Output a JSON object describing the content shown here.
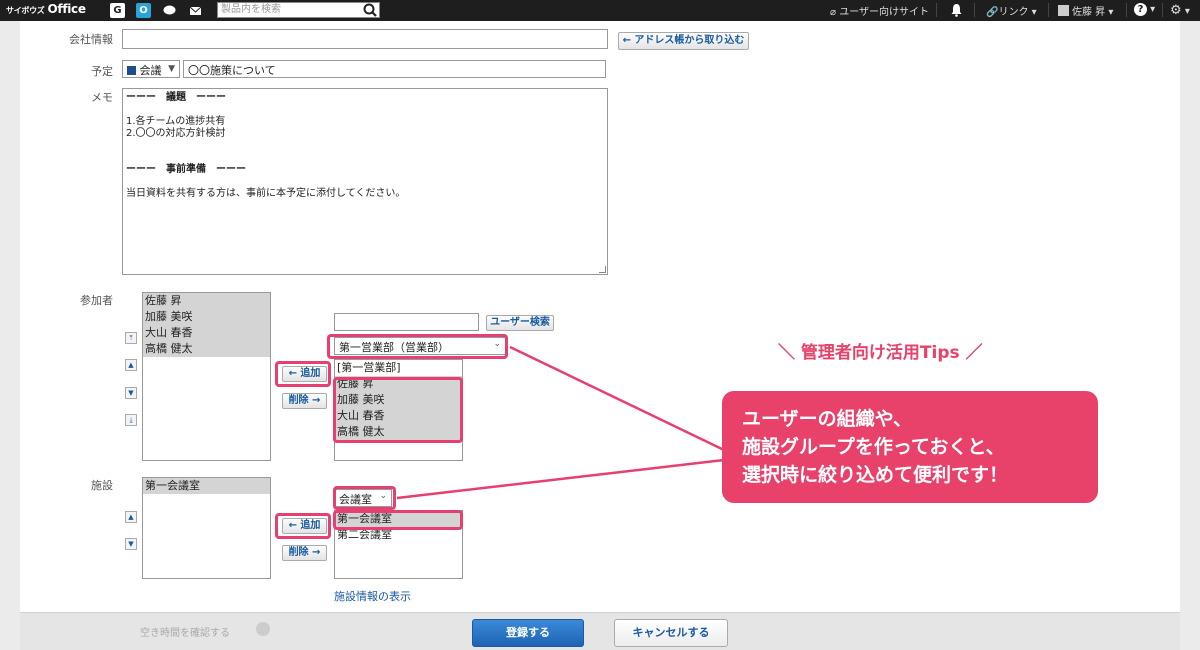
{
  "topbar": {
    "logo_small": "サイボウズ",
    "logo": "Office",
    "apps": [
      "G",
      "O"
    ],
    "search_placeholder": "製品内を検索",
    "user_site": "ユーザー向けサイト",
    "link": "リンク",
    "user": "佐藤 昇"
  },
  "form": {
    "company_label": "会社情報",
    "address_book_btn": "← アドレス帳から取り込む",
    "schedule_label": "予定",
    "category": "会議",
    "title_value": "〇〇施策について",
    "memo_label": "メモ",
    "memo_lines": [
      "ーーー　議題　ーーー",
      "",
      "1.各チームの進捗共有",
      "2.〇〇の対応方針検討",
      "",
      "",
      "ーーー　事前準備　ーーー",
      "",
      "当日資料を共有する方は、事前に本予定に添付してください。"
    ],
    "participants_label": "参加者",
    "participants": [
      "佐藤 昇",
      "加藤 美咲",
      "大山 春香",
      "高橋 健太"
    ],
    "user_search_btn": "ユーザー検索",
    "group_select": "第一営業部（営業部）",
    "group_header": "[第一営業部]",
    "group_members": [
      "佐藤 昇",
      "加藤 美咲",
      "大山 春香",
      "高橋 健太"
    ],
    "add_btn": "← 追加",
    "remove_btn": "削除 →",
    "facility_label": "施設",
    "facilities_selected": [
      "第一会議室"
    ],
    "facility_group_select": "会議室",
    "facility_options": [
      "第一会議室",
      "第二会議室"
    ],
    "facility_info_link": "施設情報の表示"
  },
  "footer": {
    "faded_text": "空き時間を確認する",
    "submit": "登録する",
    "cancel": "キャンセルする"
  },
  "annotation": {
    "tips": "＼ 管理者向け活用Tips ／",
    "callout_lines": [
      "ユーザーの組織や、",
      "施設グループを作っておくと、",
      "選択時に絞り込めて便利です！"
    ]
  },
  "colors": {
    "highlight": "#e64070",
    "callout": "#e8416a",
    "primary": "#1e64b4"
  }
}
